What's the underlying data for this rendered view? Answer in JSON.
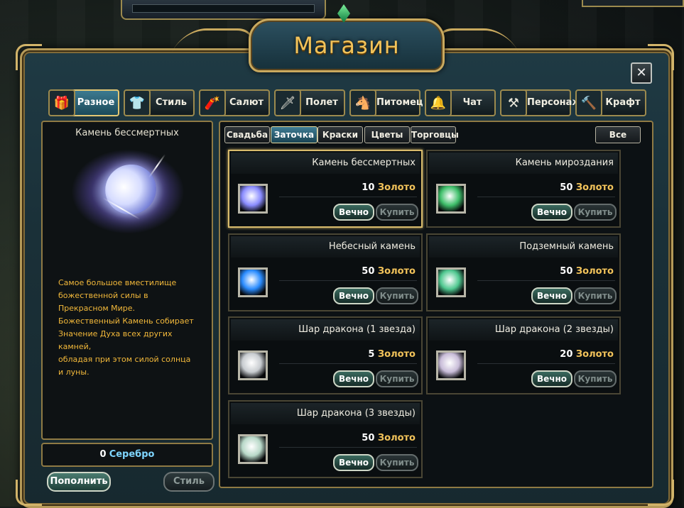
{
  "window": {
    "title": "Магазин",
    "close_icon": "✕"
  },
  "categories": [
    {
      "label": "Разное",
      "icon": "🎁",
      "active": true
    },
    {
      "label": "Стиль",
      "icon": "👕",
      "active": false
    },
    {
      "label": "Салют",
      "icon": "🧨",
      "active": false
    },
    {
      "label": "Полет",
      "icon": "🗡",
      "active": false
    },
    {
      "label": "Питомец",
      "icon": "🐴",
      "active": false
    },
    {
      "label": "Чат",
      "icon": "🔔",
      "active": false
    },
    {
      "label": "Персонаж",
      "icon": "⚒",
      "active": false
    },
    {
      "label": "Крафт",
      "icon": "🔨",
      "active": false
    }
  ],
  "subtabs": [
    {
      "label": "Свадьба",
      "active": false
    },
    {
      "label": "Заточка",
      "active": true
    },
    {
      "label": "Краски",
      "active": false
    },
    {
      "label": "Цветы",
      "active": false
    },
    {
      "label": "Торговцы",
      "active": false
    },
    {
      "label": "Все",
      "active": false
    }
  ],
  "preview": {
    "title": "Камень бессмертных",
    "description": "Самое большое вместилище\nбожественной силы в\nПрекрасном Мире.\nБожественный Камень собирает\nЗначение Духа всех других\nкамней,\nобладая при этом силой солнца\nи луны."
  },
  "balance": {
    "amount": "0",
    "currency": "Серебро"
  },
  "buttons": {
    "refill": "Пополнить",
    "style": "Стиль"
  },
  "items": [
    {
      "name": "Камень бессмертных",
      "price": "10",
      "currency": "Золото",
      "forever": "Вечно",
      "buy": "Купить",
      "icon": "immortal-stone-icon",
      "color": "#8a8cff",
      "selected": true
    },
    {
      "name": "Камень мироздания",
      "price": "50",
      "currency": "Золото",
      "forever": "Вечно",
      "buy": "Купить",
      "icon": "creation-stone-icon",
      "color": "#3fbf6a",
      "selected": false
    },
    {
      "name": "Небесный камень",
      "price": "50",
      "currency": "Золото",
      "forever": "Вечно",
      "buy": "Купить",
      "icon": "heavenly-stone-icon",
      "color": "#2a8cff",
      "selected": false
    },
    {
      "name": "Подземный камень",
      "price": "50",
      "currency": "Золото",
      "forever": "Вечно",
      "buy": "Купить",
      "icon": "underground-stone-icon",
      "color": "#50c890",
      "selected": false
    },
    {
      "name": "Шар дракона (1 звезда)",
      "price": "5",
      "currency": "Золото",
      "forever": "Вечно",
      "buy": "Купить",
      "icon": "dragon-orb-1-icon",
      "color": "#c8ccd0",
      "selected": false
    },
    {
      "name": "Шар дракона (2 звезды)",
      "price": "20",
      "currency": "Золото",
      "forever": "Вечно",
      "buy": "Купить",
      "icon": "dragon-orb-2-icon",
      "color": "#c8bcd8",
      "selected": false
    },
    {
      "name": "Шар дракона (3 звезды)",
      "price": "50",
      "currency": "Золото",
      "forever": "Вечно",
      "buy": "Купить",
      "icon": "dragon-orb-3-icon",
      "color": "#b8d8c8",
      "selected": false
    }
  ]
}
